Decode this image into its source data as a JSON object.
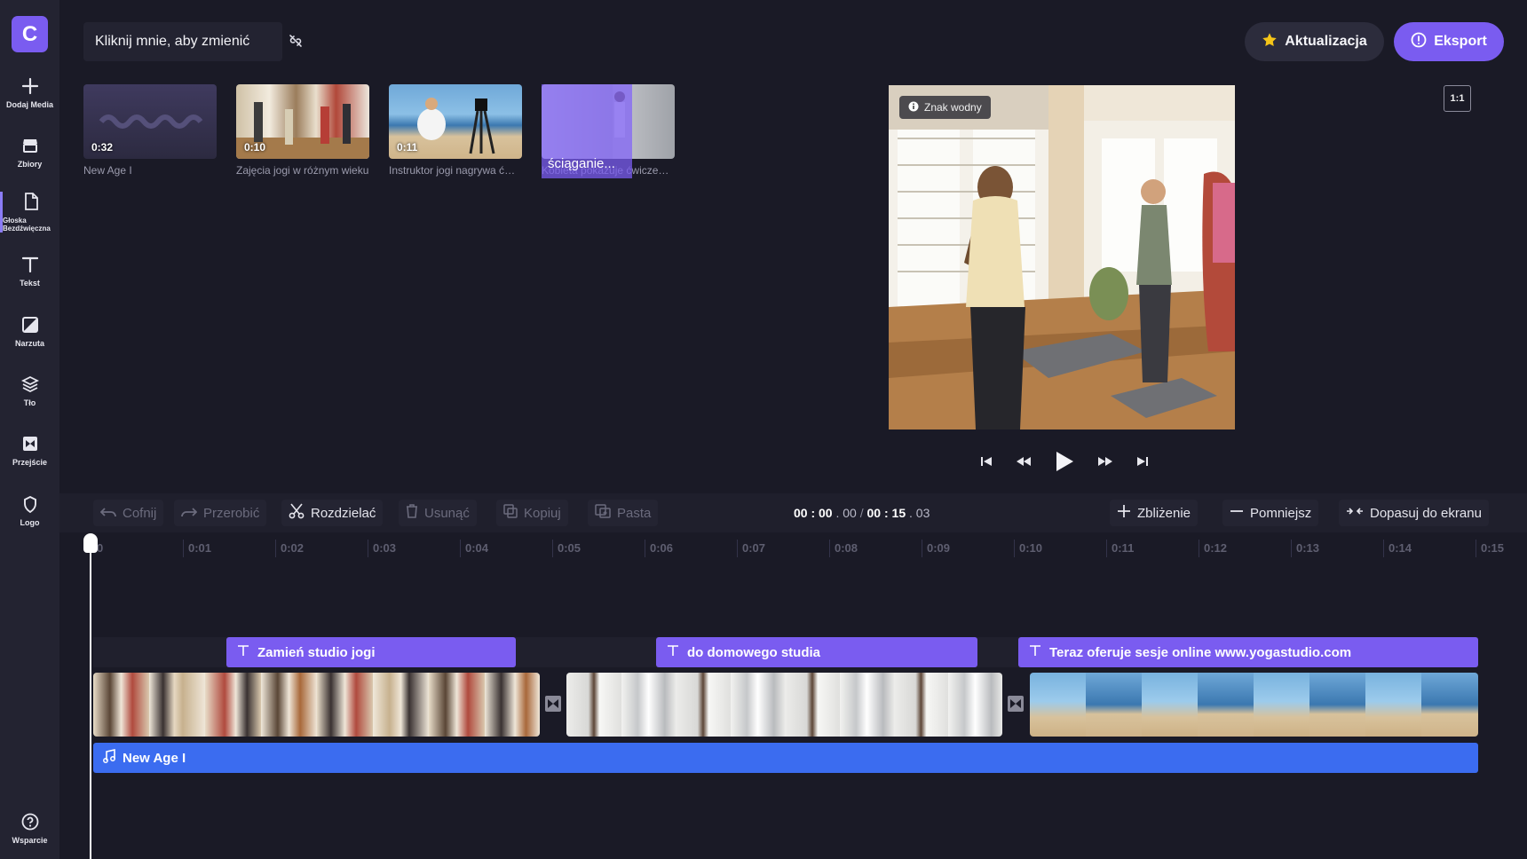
{
  "app": {
    "logo_letter": "C",
    "accent": "#7a5cf0"
  },
  "sidebar": {
    "items": [
      {
        "label": "Dodaj Media",
        "icon": "plus-icon"
      },
      {
        "label": "Zbiory",
        "icon": "store-icon"
      },
      {
        "label": "Głoska Bezdźwięczna",
        "icon": "file-icon"
      },
      {
        "label": "Tekst",
        "icon": "text-icon"
      },
      {
        "label": "Narzuta",
        "icon": "overlay-icon"
      },
      {
        "label": "Tło",
        "icon": "layers-icon"
      },
      {
        "label": "Przejście",
        "icon": "transition-icon"
      },
      {
        "label": "Logo",
        "icon": "shield-icon"
      },
      {
        "label": "Wsparcie",
        "icon": "help-icon"
      }
    ],
    "active_index": 2
  },
  "header": {
    "title": "Kliknij mnie, aby zmienić",
    "upgrade_label": "Aktualizacja",
    "export_label": "Eksport"
  },
  "media": [
    {
      "duration": "0:32",
      "name": "New Age I",
      "type": "audio"
    },
    {
      "duration": "0:10",
      "name": "Zajęcia jogi w różnym wieku",
      "type": "video"
    },
    {
      "duration": "0:11",
      "name": "Instruktor jogi nagrywa ćwiczenia",
      "type": "video"
    },
    {
      "duration": "",
      "name": "Kobieta pokazuje ćwiczenia jogi",
      "type": "video",
      "status": "ściąganie..."
    }
  ],
  "preview": {
    "watermark_label": "Znak wodny",
    "ratio_label": "1:1"
  },
  "toolbar": {
    "undo": "Cofnij",
    "redo": "Przerobić",
    "split": "Rozdzielać",
    "delete": "Usunąć",
    "copy": "Kopiuj",
    "paste": "Pasta",
    "zoom_in": "Zbliżenie",
    "zoom_out": "Pomniejsz",
    "fit": "Dopasuj do ekranu",
    "time_current_main": "00 : 00",
    "time_current_frac": ". 00",
    "time_separator": "/",
    "time_total_main": "00 : 15",
    "time_total_frac": ". 03"
  },
  "timeline": {
    "ticks": [
      "0",
      "0:01",
      "0:02",
      "0:03",
      "0:04",
      "0:05",
      "0:06",
      "0:07",
      "0:08",
      "0:09",
      "0:10",
      "0:11",
      "0:12",
      "0:13",
      "0:14",
      "0:15"
    ],
    "text_clips": [
      "Zamień studio jogi",
      "do domowego studia",
      "Teraz oferuje sesje online www.yogastudio.com"
    ],
    "audio_clip": "New Age I"
  }
}
